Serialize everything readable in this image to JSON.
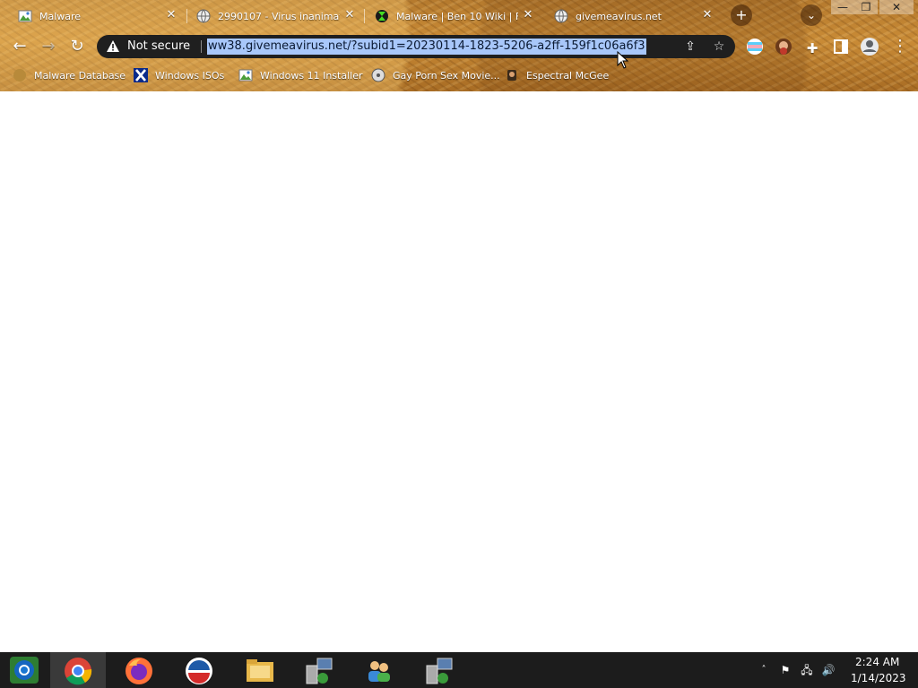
{
  "tabs": [
    {
      "title": "Malware",
      "icon": "image-favicon"
    },
    {
      "title": "2990107 - Virus inanimate",
      "icon": "globe-icon"
    },
    {
      "title": "Malware | Ben 10 Wiki | F",
      "icon": "omnitrix-icon"
    },
    {
      "title": "givemeavirus.net",
      "icon": "globe-icon",
      "active": true
    }
  ],
  "omnibox": {
    "security_status": "Not secure",
    "url": "ww38.givemeavirus.net/?subid1=20230114-1823-5206-a2ff-159f1c06a6f3"
  },
  "bookmarks": [
    {
      "label": "Malware Database",
      "icon": "sand-icon"
    },
    {
      "label": "Windows ISOs",
      "icon": "x-icon"
    },
    {
      "label": "Windows 11 Installer",
      "icon": "image-icon"
    },
    {
      "label": "Gay Porn Sex Movie...",
      "icon": "disc-icon"
    },
    {
      "label": "Espectral McGee",
      "icon": "character-icon"
    }
  ],
  "taskbar": {
    "apps": [
      "start-orb",
      "chrome",
      "firefox",
      "opera",
      "file-explorer",
      "network-setup",
      "users",
      "network-setup"
    ],
    "active_app": "chrome"
  },
  "clock": {
    "time": "2:24 AM",
    "date": "1/14/2023"
  },
  "colors": {
    "url_highlight": "#a8c7fa",
    "omnibox_bg": "#1f1f1f",
    "taskbar_bg": "#1c1c1c"
  }
}
